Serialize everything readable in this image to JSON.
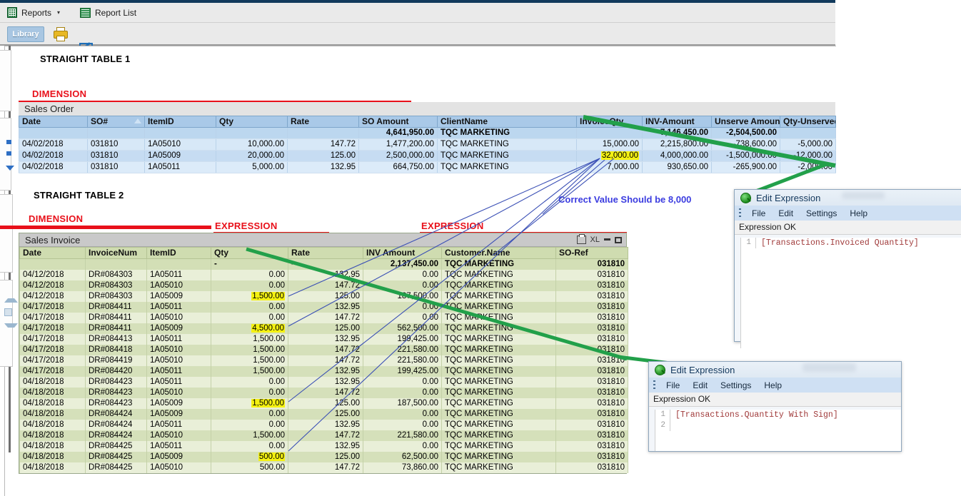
{
  "app": {
    "menubar": [
      {
        "label": "Reports",
        "icon": "grid-icon",
        "caret": "▾"
      },
      {
        "label": "Report List",
        "icon": "lines-icon",
        "caret": ""
      }
    ],
    "toolbar": {
      "library_label": "Library",
      "buttons": [
        "print-icon",
        "export-icon",
        "download-icon",
        "back-arrow-icon",
        "forward-arrow-icon"
      ]
    }
  },
  "annotations": {
    "table1_title": "STRAIGHT TABLE 1",
    "table2_title": "STRAIGHT TABLE 2",
    "dimension_1": "DIMENSION",
    "expression_1": "EXPRESSION",
    "dimension_2": "DIMENSION",
    "expression_2a": "EXPRESSION",
    "expression_2b": "EXPRESSION",
    "correct_value_note": "Correct Value Should be 8,000"
  },
  "table1": {
    "caption": "Sales Order",
    "columns": [
      "Date",
      "SO#",
      "ItemID",
      "Qty",
      "Rate",
      "SO Amount",
      "ClientName",
      "InvoiceQty",
      "INV-Amount",
      "Unserve Amount",
      "Qty-Unserved"
    ],
    "sorted_column": "SO#",
    "total_row": [
      "",
      "",
      "",
      "",
      "",
      "4,641,950.00",
      "TQC MARKETING",
      "",
      "7,146,450.00",
      "-2,504,500.00",
      ""
    ],
    "rows": [
      [
        "04/02/2018",
        "031810",
        "1A05010",
        "10,000.00",
        "147.72",
        "1,477,200.00",
        "TQC MARKETING",
        "15,000.00",
        "2,215,800.00",
        "-738,600.00",
        "-5,000.00"
      ],
      [
        "04/02/2018",
        "031810",
        "1A05009",
        "20,000.00",
        "125.00",
        "2,500,000.00",
        "TQC MARKETING",
        "32,000.00",
        "4,000,000.00",
        "-1,500,000.00",
        "-12,000.00"
      ],
      [
        "04/02/2018",
        "031810",
        "1A05011",
        "5,000.00",
        "132.95",
        "664,750.00",
        "TQC MARKETING",
        "7,000.00",
        "930,650.00",
        "-265,900.00",
        "-2,000.00"
      ]
    ],
    "highlighted_cell": {
      "row": 1,
      "column": "InvoiceQty",
      "value": "32,000.00"
    }
  },
  "table2": {
    "caption": "Sales Invoice",
    "caption_tools": [
      "print-icon",
      "XL",
      "minimize-icon",
      "maximize-icon"
    ],
    "columns": [
      "Date",
      "InvoiceNum",
      "ItemID",
      "Qty",
      "Rate",
      "INV Amount",
      "Customer.Name",
      "SO-Ref"
    ],
    "total_row": [
      "",
      "",
      "",
      "-",
      "-",
      "2,137,450.00",
      "TQC MARKETING",
      "031810"
    ],
    "rows": [
      [
        "04/12/2018",
        "DR#084303",
        "1A05011",
        "0.00",
        "132.95",
        "0.00",
        "TQC MARKETING",
        "031810"
      ],
      [
        "04/12/2018",
        "DR#084303",
        "1A05010",
        "0.00",
        "147.72",
        "0.00",
        "TQC MARKETING",
        "031810"
      ],
      [
        "04/12/2018",
        "DR#084303",
        "1A05009",
        "1,500.00",
        "125.00",
        "187,500.00",
        "TQC MARKETING",
        "031810"
      ],
      [
        "04/17/2018",
        "DR#084411",
        "1A05011",
        "0.00",
        "132.95",
        "0.00",
        "TQC MARKETING",
        "031810"
      ],
      [
        "04/17/2018",
        "DR#084411",
        "1A05010",
        "0.00",
        "147.72",
        "0.00",
        "TQC MARKETING",
        "031810"
      ],
      [
        "04/17/2018",
        "DR#084411",
        "1A05009",
        "4,500.00",
        "125.00",
        "562,500.00",
        "TQC MARKETING",
        "031810"
      ],
      [
        "04/17/2018",
        "DR#084413",
        "1A05011",
        "1,500.00",
        "132.95",
        "199,425.00",
        "TQC MARKETING",
        "031810"
      ],
      [
        "04/17/2018",
        "DR#084418",
        "1A05010",
        "1,500.00",
        "147.72",
        "221,580.00",
        "TQC MARKETING",
        "031810"
      ],
      [
        "04/17/2018",
        "DR#084419",
        "1A05010",
        "1,500.00",
        "147.72",
        "221,580.00",
        "TQC MARKETING",
        "031810"
      ],
      [
        "04/17/2018",
        "DR#084420",
        "1A05011",
        "1,500.00",
        "132.95",
        "199,425.00",
        "TQC MARKETING",
        "031810"
      ],
      [
        "04/18/2018",
        "DR#084423",
        "1A05011",
        "0.00",
        "132.95",
        "0.00",
        "TQC MARKETING",
        "031810"
      ],
      [
        "04/18/2018",
        "DR#084423",
        "1A05010",
        "0.00",
        "147.72",
        "0.00",
        "TQC MARKETING",
        "031810"
      ],
      [
        "04/18/2018",
        "DR#084423",
        "1A05009",
        "1,500.00",
        "125.00",
        "187,500.00",
        "TQC MARKETING",
        "031810"
      ],
      [
        "04/18/2018",
        "DR#084424",
        "1A05009",
        "0.00",
        "125.00",
        "0.00",
        "TQC MARKETING",
        "031810"
      ],
      [
        "04/18/2018",
        "DR#084424",
        "1A05011",
        "0.00",
        "132.95",
        "0.00",
        "TQC MARKETING",
        "031810"
      ],
      [
        "04/18/2018",
        "DR#084424",
        "1A05010",
        "1,500.00",
        "147.72",
        "221,580.00",
        "TQC MARKETING",
        "031810"
      ],
      [
        "04/18/2018",
        "DR#084425",
        "1A05011",
        "0.00",
        "132.95",
        "0.00",
        "TQC MARKETING",
        "031810"
      ],
      [
        "04/18/2018",
        "DR#084425",
        "1A05009",
        "500.00",
        "125.00",
        "62,500.00",
        "TQC MARKETING",
        "031810"
      ],
      [
        "04/18/2018",
        "DR#084425",
        "1A05010",
        "500.00",
        "147.72",
        "73,860.00",
        "TQC MARKETING",
        "031810"
      ]
    ],
    "highlighted_qty_rows": [
      2,
      5,
      12,
      17
    ]
  },
  "dialog_top": {
    "title": "Edit Expression",
    "menu": [
      "File",
      "Edit",
      "Settings",
      "Help"
    ],
    "status": "Expression OK",
    "lines": [
      "1"
    ],
    "code": "[Transactions.Invoiced Quantity]"
  },
  "dialog_bottom": {
    "title": "Edit Expression",
    "menu": [
      "File",
      "Edit",
      "Settings",
      "Help"
    ],
    "status": "Expression OK",
    "lines": [
      "1",
      "2"
    ],
    "code": "[Transactions.Quantity With Sign]"
  },
  "colors": {
    "annotation_red": "#e8101a",
    "note_blue": "#3b3ce0",
    "highlight_yellow": "#f4f112",
    "pointer_green": "#22a04a",
    "pointer_blue": "#3a4fb5",
    "table1_header": "#a9c9e8",
    "table2_header": "#cfdcb0"
  }
}
